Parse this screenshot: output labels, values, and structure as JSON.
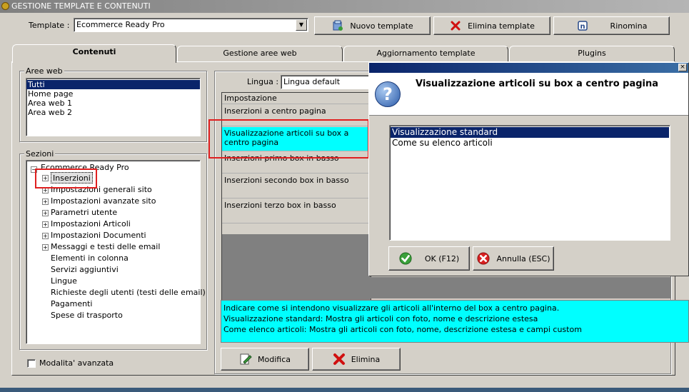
{
  "window": {
    "title": "GESTIONE TEMPLATE E CONTENUTI"
  },
  "toolbar": {
    "template_label": "Template :",
    "template_value": "Ecommerce Ready Pro",
    "new_template": "Nuovo template",
    "delete_template": "Elimina template",
    "rename": "Rinomina"
  },
  "tabs": [
    {
      "label": "Contenuti",
      "active": true
    },
    {
      "label": "Gestione aree web"
    },
    {
      "label": "Aggiornamento template"
    },
    {
      "label": "Plugins"
    }
  ],
  "aree_web": {
    "label": "Aree web",
    "items": [
      "Tutti",
      "Home page",
      "Area web 1",
      "Area web 2"
    ],
    "selected": "Tutti"
  },
  "sezioni": {
    "label": "Sezioni",
    "root": "Ecommerce Ready Pro",
    "items": [
      {
        "label": "Inserzioni",
        "expandable": true,
        "selected": true
      },
      {
        "label": "Impostazioni generali sito",
        "expandable": true
      },
      {
        "label": "Impostazioni avanzate sito",
        "expandable": true
      },
      {
        "label": "Parametri utente",
        "expandable": true
      },
      {
        "label": "Impostazioni Articoli",
        "expandable": true
      },
      {
        "label": "Impostazioni Documenti",
        "expandable": true
      },
      {
        "label": "Messaggi e testi delle email",
        "expandable": true
      },
      {
        "label": "Elementi in colonna",
        "expandable": false
      },
      {
        "label": "Servizi aggiuntivi",
        "expandable": false
      },
      {
        "label": "Lingue",
        "expandable": false
      },
      {
        "label": "Richieste degli utenti (testi delle email)",
        "expandable": false
      },
      {
        "label": "Pagamenti",
        "expandable": false
      },
      {
        "label": "Spese di trasporto",
        "expandable": false
      }
    ]
  },
  "advanced_mode": {
    "label": "Modalita' avanzata",
    "checked": false
  },
  "lingua": {
    "label": "Lingua :",
    "value": "Lingua default"
  },
  "settings_grid": {
    "header": "Impostazione",
    "rows": [
      "Inserzioni a centro pagina",
      "Visualizzazione articoli su box a centro pagina",
      "Inserzioni primo box in basso",
      "Inserzioni secondo box in basso",
      "Inserzioni terzo box in basso"
    ],
    "selected_index": 1
  },
  "description": {
    "lines": [
      "Indicare come si intendono visualizzare gli articoli all'interno del box a centro pagina.",
      "Visualizzazione standard: Mostra gli articoli con foto, nome e descrizione estesa",
      "Come elenco articoli: Mostra gli articoli con foto, nome, descrizione estesa e campi custom"
    ]
  },
  "actions": {
    "modify": "Modifica",
    "delete": "Elimina"
  },
  "dialog": {
    "title": "Visualizzazione articoli su box a centro pagina",
    "options": [
      "Visualizzazione standard",
      "Come su elenco articoli"
    ],
    "selected": "Visualizzazione standard",
    "ok": "OK (F12)",
    "cancel": "Annulla (ESC)"
  },
  "colors": {
    "selection": "#0a246a",
    "highlight_cyan": "#00ffff",
    "annotation_red": "#e02020",
    "window_bg": "#d4d0c8"
  }
}
